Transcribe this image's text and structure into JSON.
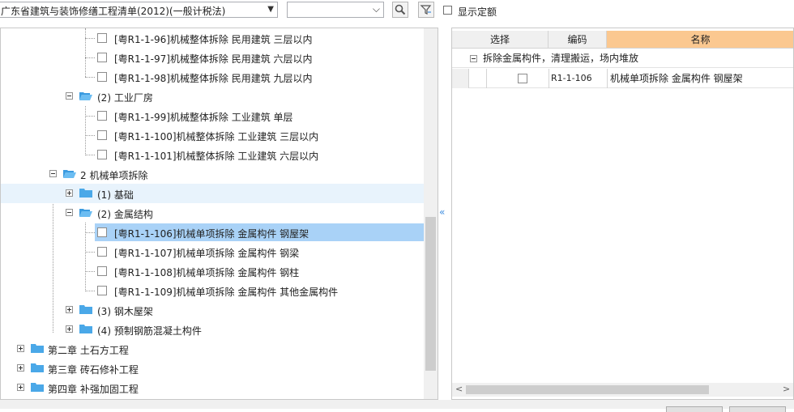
{
  "toolbar": {
    "library_value": "广东省建筑与装饰修缮工程清单(2012)(一般计税法)",
    "search_value": "",
    "show_quota_label": "显示定额"
  },
  "tree": {
    "rows": [
      {
        "text": "[粤R1-1-96]机械整体拆除 民用建筑 三层以内"
      },
      {
        "text": "[粤R1-1-97]机械整体拆除 民用建筑 六层以内"
      },
      {
        "text": "[粤R1-1-98]机械整体拆除 民用建筑 九层以内"
      },
      {
        "text": "(2) 工业厂房"
      },
      {
        "text": "[粤R1-1-99]机械整体拆除 工业建筑 单层"
      },
      {
        "text": "[粤R1-1-100]机械整体拆除 工业建筑 三层以内"
      },
      {
        "text": "[粤R1-1-101]机械整体拆除 工业建筑 六层以内"
      },
      {
        "text": "2 机械单项拆除"
      },
      {
        "text": "(1) 基础"
      },
      {
        "text": "(2) 金属结构"
      },
      {
        "text": "[粤R1-1-106]机械单项拆除 金属构件 钢屋架"
      },
      {
        "text": "[粤R1-1-107]机械单项拆除 金属构件 钢梁"
      },
      {
        "text": "[粤R1-1-108]机械单项拆除 金属构件 钢柱"
      },
      {
        "text": "[粤R1-1-109]机械单项拆除 金属构件 其他金属构件"
      },
      {
        "text": "(3) 钢木屋架"
      },
      {
        "text": "(4) 预制钢筋混凝土构件"
      },
      {
        "text": "第二章 土石方工程"
      },
      {
        "text": "第三章 砖石修补工程"
      },
      {
        "text": "第四章 补强加固工程"
      }
    ]
  },
  "grid": {
    "headers": {
      "select": "选择",
      "code": "编码",
      "name": "名称"
    },
    "group": "拆除金属构件，清理搬运，场内堆放",
    "row": {
      "code": "R1-1-106",
      "name": "机械单项拆除 金属构件 钢屋架"
    }
  },
  "colors": {
    "accent_header": "#fbc890",
    "selection": "#a9d2f7",
    "hover": "#e8f3fc",
    "folder": "#4aa8e8"
  }
}
